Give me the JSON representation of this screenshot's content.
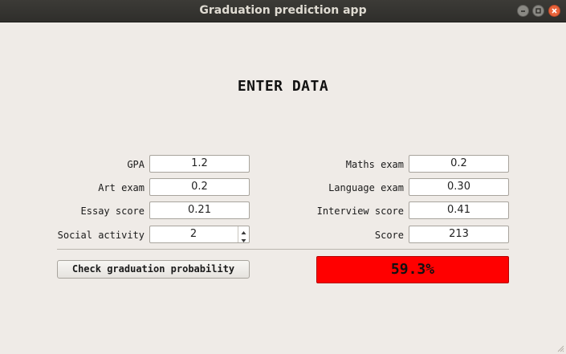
{
  "window": {
    "title": "Graduation prediction app"
  },
  "heading": "ENTER DATA",
  "left_fields": [
    {
      "label": "GPA",
      "value": "1.2"
    },
    {
      "label": "Art exam",
      "value": "0.2"
    },
    {
      "label": "Essay score",
      "value": "0.21"
    },
    {
      "label": "Social activity",
      "value": "2"
    }
  ],
  "right_fields": [
    {
      "label": "Maths exam",
      "value": "0.2"
    },
    {
      "label": "Language exam",
      "value": "0.30"
    },
    {
      "label": "Interview score",
      "value": "0.41"
    },
    {
      "label": "Score",
      "value": "213"
    }
  ],
  "actions": {
    "check_label": "Check graduation probability"
  },
  "result": {
    "text": "59.3%",
    "background_color": "#ff0000"
  },
  "icons": [
    "minimize-icon",
    "maximize-icon",
    "close-icon",
    "spin-up-icon",
    "spin-down-icon",
    "resize-grip-icon"
  ]
}
